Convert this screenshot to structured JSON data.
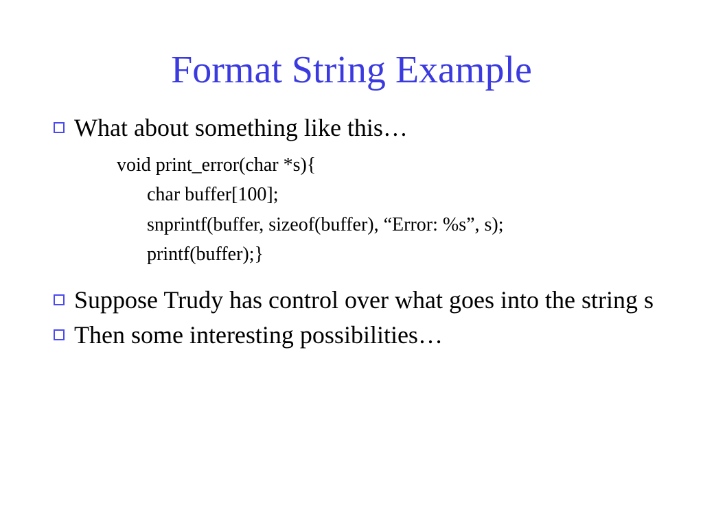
{
  "title": "Format String Example",
  "bullets": {
    "b1": "What about something like this…",
    "b2_pre": "Suppose Trudy has control over what goes into the string ",
    "b2_s": "s",
    "b3": "Then some interesting possibilities…"
  },
  "code": {
    "l1": "void print_error(char *s){",
    "l2": "char buffer[100];",
    "l3": "snprintf(buffer, sizeof(buffer), “Error: %s”, s);",
    "l4": "printf(buffer);}"
  }
}
